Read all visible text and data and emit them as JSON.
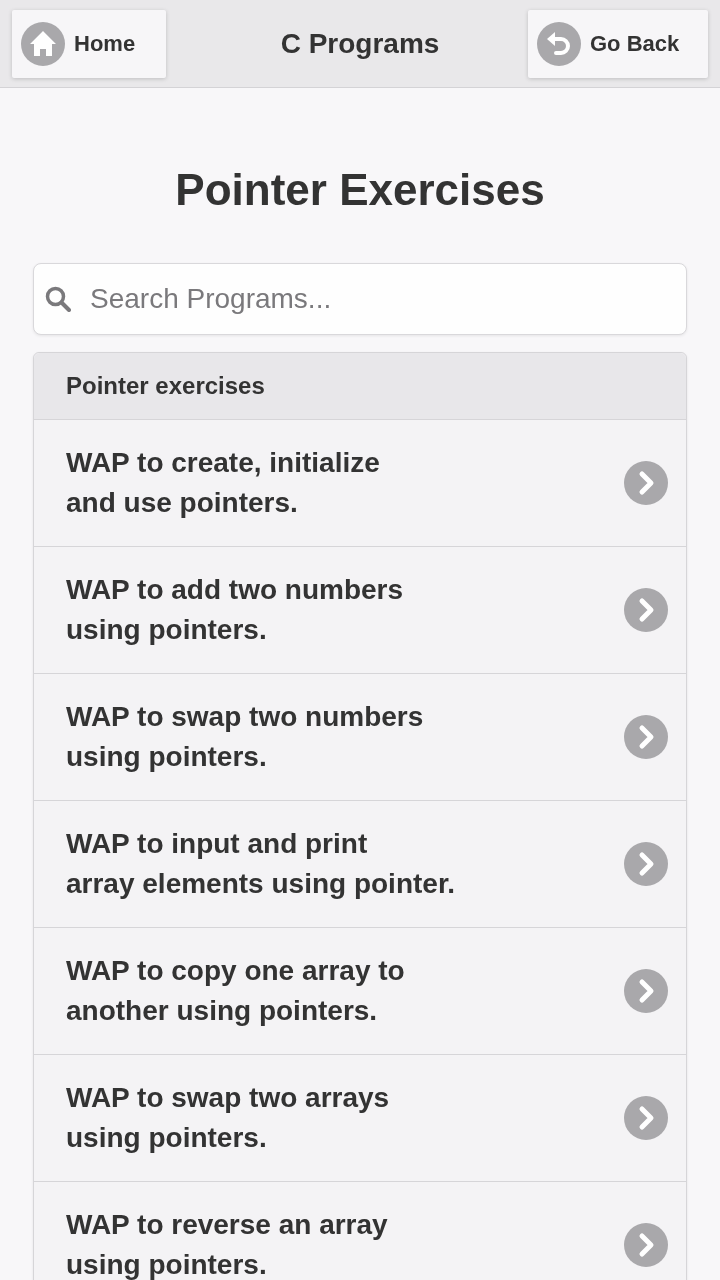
{
  "header": {
    "home_button": {
      "label": "Home"
    },
    "title": "C Programs",
    "back_button": {
      "label": "Go Back"
    }
  },
  "page_title": "Pointer Exercises",
  "search": {
    "placeholder": "Search Programs..."
  },
  "list": {
    "heading": "Pointer exercises",
    "items": [
      {
        "lines": [
          "WAP to create, initialize",
          "and use pointers."
        ]
      },
      {
        "lines": [
          "WAP to add two numbers",
          "using pointers."
        ]
      },
      {
        "lines": [
          "WAP to swap two numbers",
          "using pointers."
        ]
      },
      {
        "lines": [
          "WAP to input and print",
          "array elements using pointer."
        ]
      },
      {
        "lines": [
          "WAP to copy one array to",
          "another using pointers."
        ]
      },
      {
        "lines": [
          "WAP to swap two arrays",
          "using pointers."
        ]
      },
      {
        "lines": [
          "WAP to reverse an array",
          "using pointers."
        ]
      }
    ]
  }
}
